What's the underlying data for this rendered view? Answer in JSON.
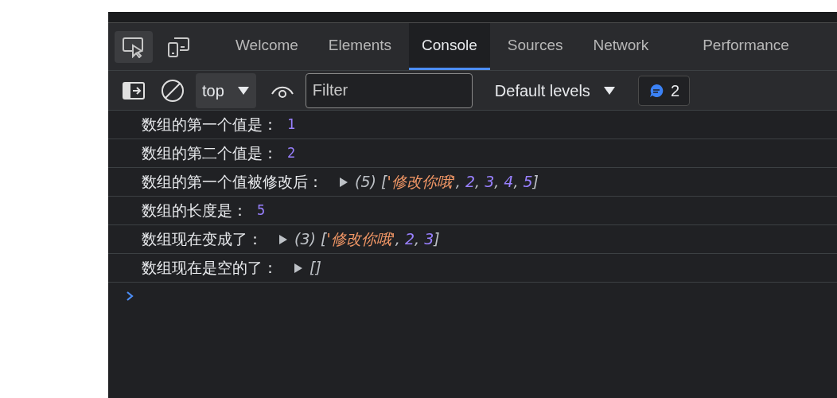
{
  "tabs": [
    {
      "label": "Welcome",
      "selected": false
    },
    {
      "label": "Elements",
      "selected": false
    },
    {
      "label": "Console",
      "selected": true
    },
    {
      "label": "Sources",
      "selected": false
    },
    {
      "label": "Network",
      "selected": false
    },
    {
      "label": "Performance",
      "selected": false
    }
  ],
  "inspect_tool": {
    "selected": true
  },
  "toolbar": {
    "context": "top",
    "filter": {
      "placeholder": "Filter"
    },
    "levels": "Default levels",
    "message_count": "2"
  },
  "log": [
    {
      "kind": "number",
      "label": "数组的第一个值是：",
      "value": "1"
    },
    {
      "kind": "number",
      "label": "数组的第二个值是：",
      "value": "2"
    },
    {
      "kind": "array",
      "label": "数组的第一个值被修改后：",
      "tokens": [
        {
          "kind": "meta",
          "text": "(5)"
        },
        {
          "kind": "meta",
          "text": "["
        },
        {
          "kind": "string",
          "text": "'修改你哦'"
        },
        {
          "kind": "meta",
          "text": ","
        },
        {
          "kind": "number",
          "text": "2"
        },
        {
          "kind": "meta",
          "text": ","
        },
        {
          "kind": "number",
          "text": "3"
        },
        {
          "kind": "meta",
          "text": ","
        },
        {
          "kind": "number",
          "text": "4"
        },
        {
          "kind": "meta",
          "text": ","
        },
        {
          "kind": "number",
          "text": "5"
        },
        {
          "kind": "meta",
          "text": "]"
        }
      ]
    },
    {
      "kind": "number",
      "label": "数组的长度是：",
      "value": "5"
    },
    {
      "kind": "array",
      "label": "数组现在变成了：",
      "tokens": [
        {
          "kind": "meta",
          "text": "(3)"
        },
        {
          "kind": "meta",
          "text": "["
        },
        {
          "kind": "string",
          "text": "'修改你哦'"
        },
        {
          "kind": "meta",
          "text": ","
        },
        {
          "kind": "number",
          "text": "2"
        },
        {
          "kind": "meta",
          "text": ","
        },
        {
          "kind": "number",
          "text": "3"
        },
        {
          "kind": "meta",
          "text": "]"
        }
      ]
    },
    {
      "kind": "array",
      "label": "数组现在是空的了：",
      "tokens": [
        {
          "kind": "meta",
          "text": "[]"
        }
      ]
    }
  ]
}
